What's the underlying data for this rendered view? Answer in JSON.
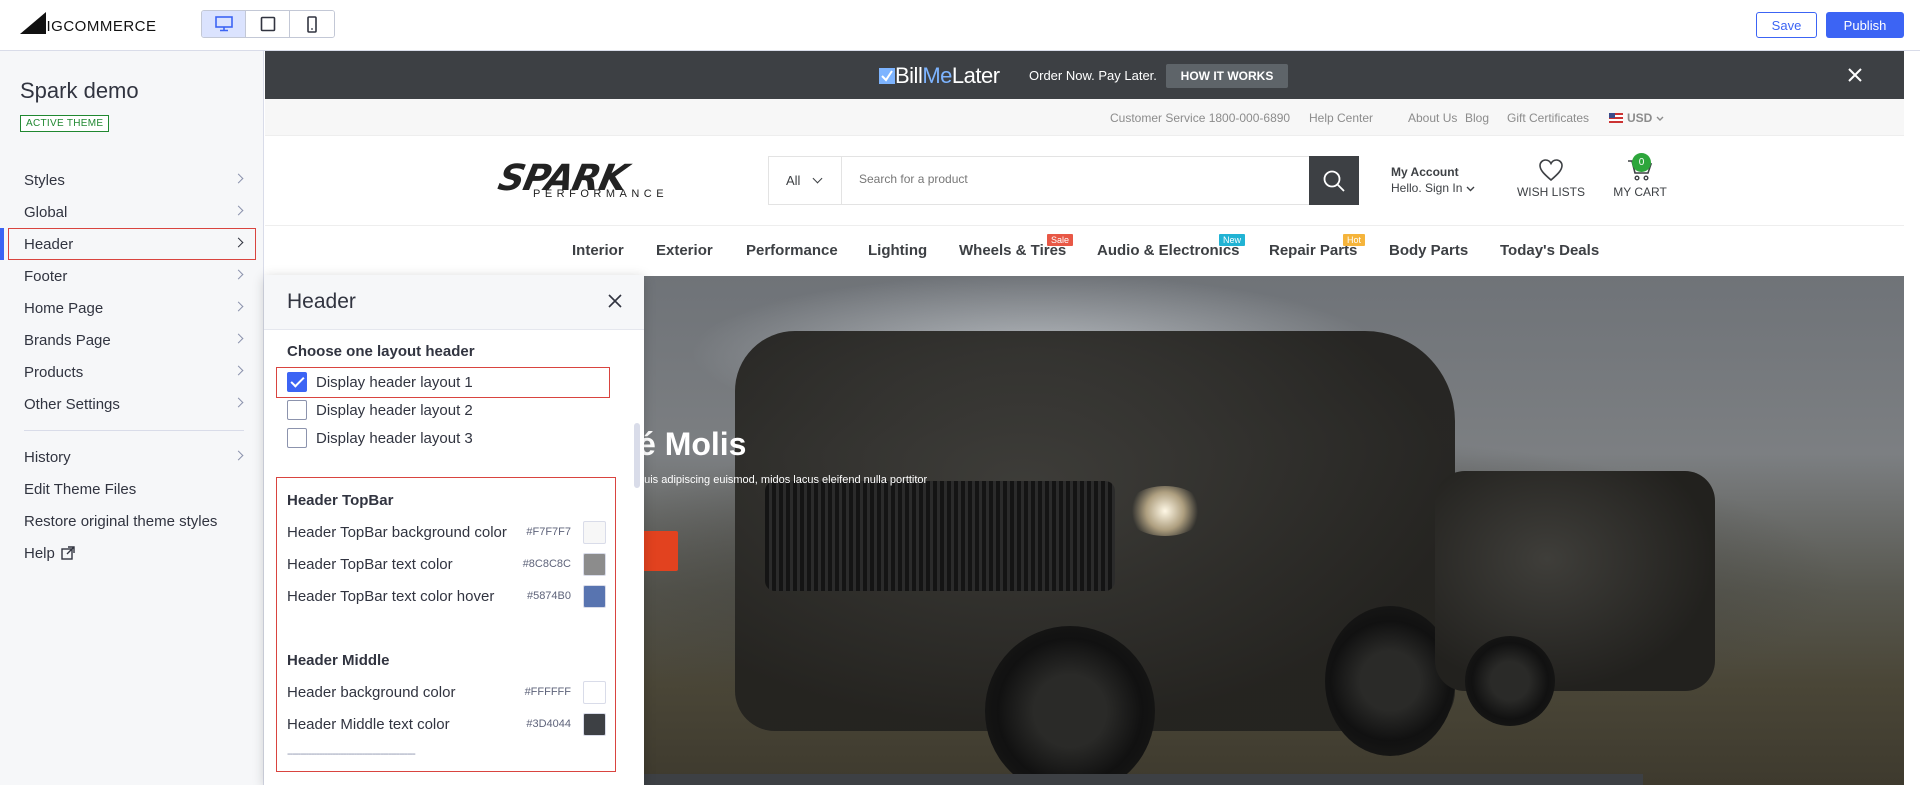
{
  "brand": {
    "logo_text": "BIGCOMMERCE"
  },
  "toolbar": {
    "devices": [
      "desktop-icon",
      "tablet-icon",
      "mobile-icon"
    ],
    "save_label": "Save",
    "publish_label": "Publish"
  },
  "sidebar": {
    "store_name": "Spark demo",
    "theme_badge": "ACTIVE THEME",
    "items": [
      {
        "label": "Styles"
      },
      {
        "label": "Global"
      },
      {
        "label": "Header"
      },
      {
        "label": "Footer"
      },
      {
        "label": "Home Page"
      },
      {
        "label": "Brands Page"
      },
      {
        "label": "Products"
      },
      {
        "label": "Other Settings"
      }
    ],
    "lower_items": [
      {
        "label": "History"
      },
      {
        "label": "Edit Theme Files"
      },
      {
        "label": "Restore original theme styles"
      },
      {
        "label": "Help"
      }
    ]
  },
  "panel": {
    "title": "Header",
    "layout_section": "Choose one layout header",
    "layouts": [
      {
        "label": "Display header layout 1",
        "checked": true
      },
      {
        "label": "Display header layout 2",
        "checked": false
      },
      {
        "label": "Display header layout 3",
        "checked": false
      }
    ],
    "topbar_section": "Header TopBar",
    "topbar_colors": [
      {
        "label": "Header TopBar background color",
        "hex": "#F7F7F7"
      },
      {
        "label": "Header TopBar text color",
        "hex": "#8C8C8C"
      },
      {
        "label": "Header TopBar text color hover",
        "hex": "#5874B0"
      }
    ],
    "middle_section": "Header Middle",
    "middle_colors": [
      {
        "label": "Header background color",
        "hex": "#FFFFFF"
      },
      {
        "label": "Header Middle text color",
        "hex": "#3D4044"
      }
    ],
    "separator": "------------------------------------------------"
  },
  "preview": {
    "promo": {
      "brand_1": "Bill",
      "brand_2": "Me",
      "brand_3": "Later",
      "text": "Order Now. Pay Later.",
      "button": "HOW IT WORKS"
    },
    "topnav": [
      "Customer Service 1800-000-6890",
      "Help Center",
      "About Us",
      "Blog",
      "Gift Certificates"
    ],
    "currency": "USD",
    "logo_main": "SPARK",
    "logo_sub": "PERFORMANCE",
    "search_scope": "All",
    "search_placeholder": "Search for a product",
    "account_title": "My Account",
    "account_sub": "Hello. Sign In",
    "wishlist": "WISH LISTS",
    "cart": "MY CART",
    "cart_count": "0",
    "menu": [
      {
        "label": "Interior"
      },
      {
        "label": "Exterior"
      },
      {
        "label": "Performance"
      },
      {
        "label": "Lighting"
      },
      {
        "label": "Wheels & Tires",
        "tag": "Sale"
      },
      {
        "label": "Audio & Electronics",
        "tag": "New"
      },
      {
        "label": "Repair Parts",
        "tag": "Hot"
      },
      {
        "label": "Body Parts"
      },
      {
        "label": "Today's Deals"
      }
    ],
    "tag_colors": {
      "Sale": "#e85846",
      "New": "#21b3d4",
      "Hot": "#f5b43b"
    },
    "hero_title": "é Molis",
    "hero_sub": "quis adipiscing euismod, midos lacus eleifend nulla porttitor"
  },
  "colors": {
    "accent": "#3C64F4",
    "highlight": "#D9443F",
    "success": "#208831"
  }
}
